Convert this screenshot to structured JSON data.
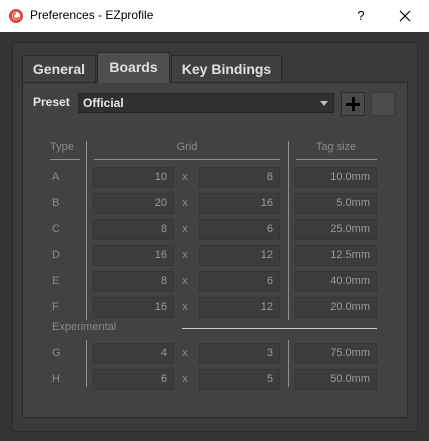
{
  "window": {
    "title": "Preferences - EZprofile",
    "help_label": "?"
  },
  "tabs": [
    {
      "label": "General",
      "active": false
    },
    {
      "label": "Boards",
      "active": true
    },
    {
      "label": "Key Bindings",
      "active": false
    }
  ],
  "preset": {
    "label": "Preset",
    "value": "Official"
  },
  "table": {
    "headers": {
      "type": "Type",
      "grid": "Grid",
      "tag_size": "Tag size"
    },
    "separator": "x",
    "rows": [
      {
        "type": "A",
        "width": "10",
        "height": "8",
        "tag": "10.0mm"
      },
      {
        "type": "B",
        "width": "20",
        "height": "16",
        "tag": "5.0mm"
      },
      {
        "type": "C",
        "width": "8",
        "height": "6",
        "tag": "25.0mm"
      },
      {
        "type": "D",
        "width": "16",
        "height": "12",
        "tag": "12.5mm"
      },
      {
        "type": "E",
        "width": "8",
        "height": "6",
        "tag": "40.0mm"
      },
      {
        "type": "F",
        "width": "16",
        "height": "12",
        "tag": "20.0mm"
      }
    ],
    "experimental_label": "Experimental",
    "experimental_rows": [
      {
        "type": "G",
        "width": "4",
        "height": "3",
        "tag": "75.0mm"
      },
      {
        "type": "H",
        "width": "6",
        "height": "5",
        "tag": "50.0mm"
      }
    ]
  },
  "colors": {
    "titlebar": "#ffffff",
    "background": "#353535",
    "panel": "#424242",
    "field": "#3c3c3c",
    "app_icon": "#e0453a"
  }
}
